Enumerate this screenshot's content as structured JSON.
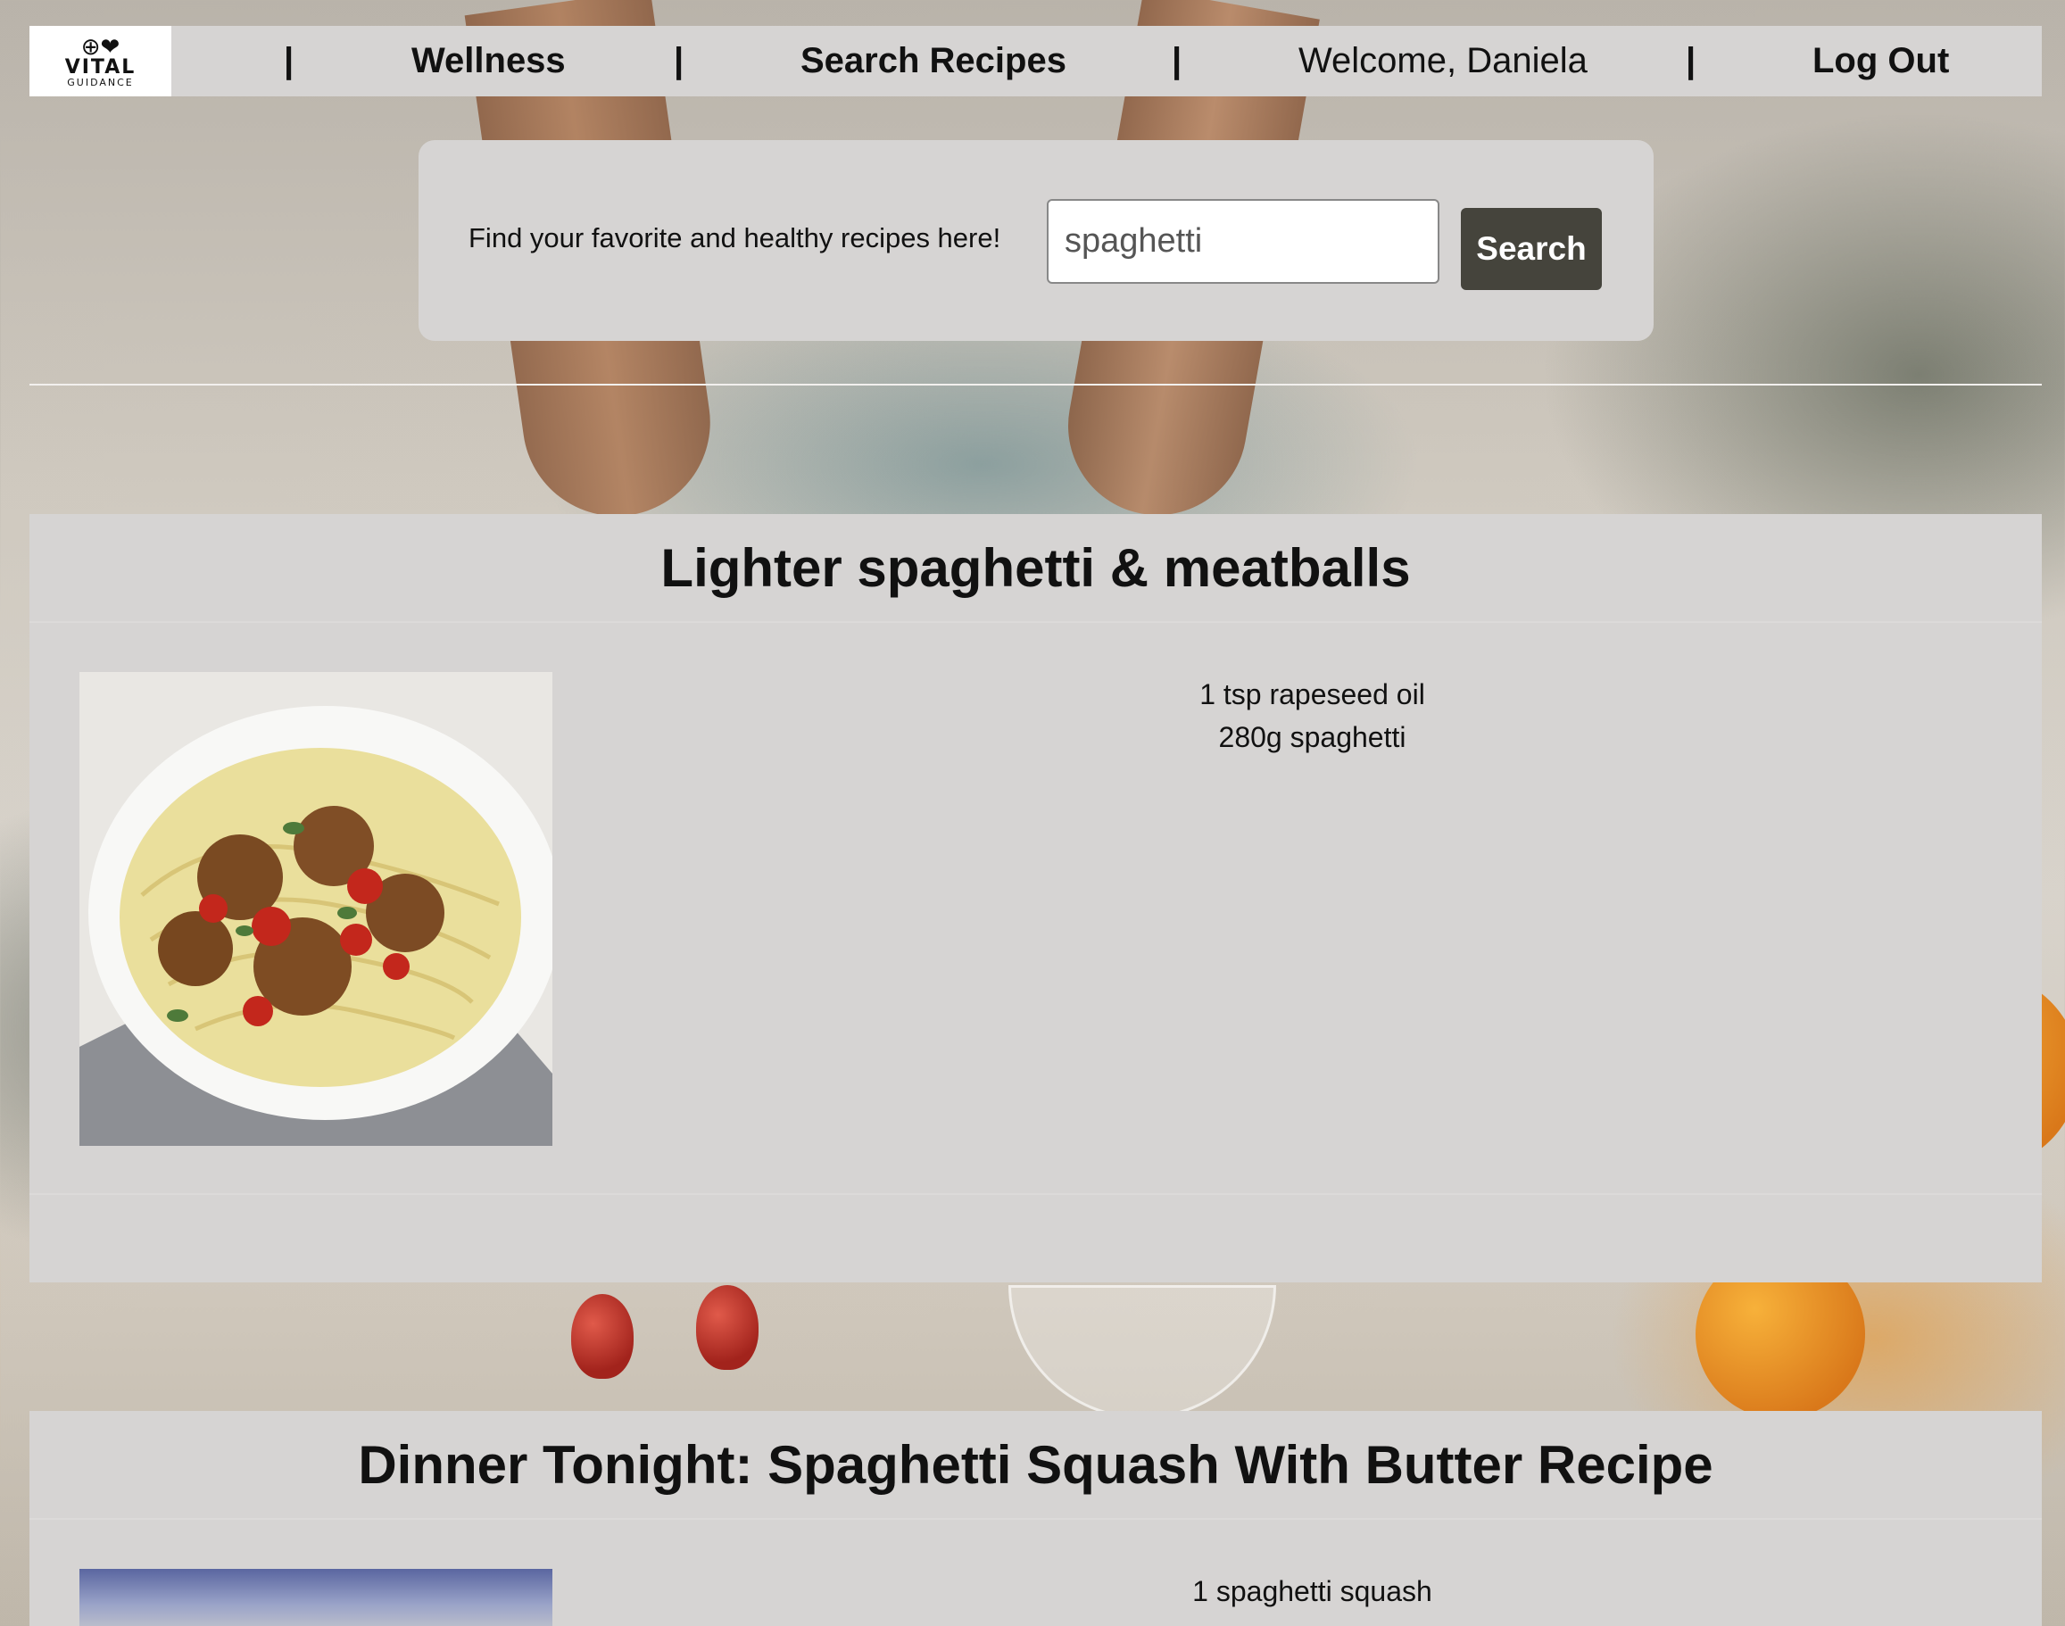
{
  "nav": {
    "logo": {
      "mark": "⊕❤",
      "name": "VITAL",
      "tagline": "GUIDANCE"
    },
    "separator": "|",
    "wellness": "Wellness",
    "search_recipes": "Search Recipes",
    "welcome": "Welcome, Daniela",
    "logout": "Log Out"
  },
  "search": {
    "prompt": "Find your favorite and healthy recipes here!",
    "value": "spaghetti",
    "button_label": "Search"
  },
  "recipes": [
    {
      "title": "Lighter spaghetti & meatballs",
      "image_icon": "spaghetti-meatballs-photo",
      "ingredients": [
        "1 tsp rapeseed oil",
        "280g spaghetti"
      ]
    },
    {
      "title": "Dinner Tonight: Spaghetti Squash With Butter Recipe",
      "image_icon": "spaghetti-squash-photo",
      "ingredients": [
        "1 spaghetti squash"
      ]
    }
  ],
  "colors": {
    "panel": "#d6d4d3",
    "button": "#45443c",
    "text": "#111111"
  }
}
